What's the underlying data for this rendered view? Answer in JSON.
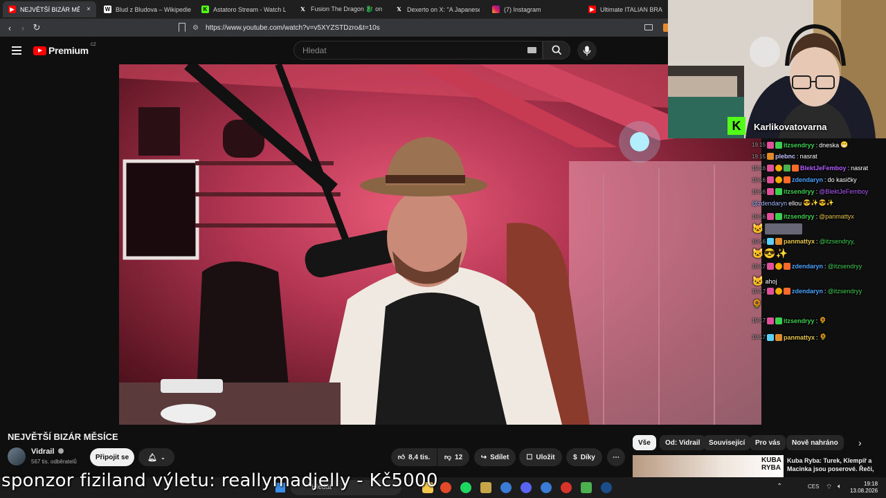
{
  "browser": {
    "tabs": [
      {
        "title": "NEJVĚTŠÍ BIZÁR MĚSÍCE",
        "icon": "youtube-icon",
        "active": true,
        "close": "×"
      },
      {
        "title": "Blud z Bludova – Wikipedie",
        "icon": "wikipedia-icon"
      },
      {
        "title": "Astatoro Stream - Watch Live",
        "icon": "kick-icon"
      },
      {
        "title": "Fusion The Dragon 🐉 on X: \"",
        "icon": "x-icon"
      },
      {
        "title": "Dexerto on X: \"A Japanese ind",
        "icon": "x-icon"
      },
      {
        "title": "(7) Instagram",
        "icon": "instagram-icon"
      },
      {
        "title": "Ultimate ITALIAN BRAINROT",
        "icon": "youtube-icon"
      }
    ],
    "url": "https://www.youtube.com/watch?v=v5XYZSTDzro&t=10s"
  },
  "youtube": {
    "logo_text": "Premium",
    "region": "CZ",
    "search_placeholder": "Hledat",
    "video_title": "NEJVĚTŠÍ BIZÁR MĚSÍCE",
    "channel_name": "Vidrail",
    "subscribers": "567 tis. odběratelů",
    "join_label": "Připojit se",
    "likes": "8,4 tis.",
    "dislikes": "12",
    "share_label": "Sdílet",
    "save_label": "Uložit",
    "thanks_label": "Díky",
    "chips": [
      "Vše",
      "Od: Vidrail",
      "Související",
      "Pro vás",
      "Nově nahráno"
    ],
    "recommended": {
      "title": "Kuba Ryba: Turek, Klempíř a Macinka jsou poserové. Řeči,",
      "thumb_text": "KUBA RYBA"
    }
  },
  "stream": {
    "channel": "Karlikovatovarna",
    "chat": [
      {
        "time": "19:15",
        "user": "itzsendryy",
        "color": "#3ecf4e",
        "text": "dneska"
      },
      {
        "time": "19:15",
        "user": "plebnc",
        "color": "#c2c2ff",
        "text": "nasrat"
      },
      {
        "time": "19:16",
        "user": "BlektJeFemboy",
        "color": "#b05cff",
        "text": "nasrat"
      },
      {
        "time": "19:16",
        "user": "zdendaryn",
        "color": "#4aa3ff",
        "text": "do kasičky"
      },
      {
        "time": "19:16",
        "user": "itzsendryy",
        "color": "#3ecf4e",
        "text": "@BlektJeFemboy"
      },
      {
        "time": "",
        "user": "@zdendaryn",
        "color": "#9db8ff",
        "text": "ellou"
      },
      {
        "time": "19:16",
        "user": "itzsendryy",
        "color": "#3ecf4e",
        "text": "@panmattyx"
      },
      {
        "time": "19:16",
        "user": "panmattyx",
        "color": "#e6c44a",
        "text": "@itzsendryy,"
      },
      {
        "time": "19:17",
        "user": "zdendaryn",
        "color": "#4aa3ff",
        "text": "@itzsendryy"
      },
      {
        "time": "",
        "user": "",
        "color": "#ffffff",
        "text": "ahoj"
      },
      {
        "time": "19:17",
        "user": "zdendaryn",
        "color": "#4aa3ff",
        "text": "@itzsendryy"
      },
      {
        "time": "19:17",
        "user": "itzsendryy",
        "color": "#3ecf4e",
        "text": ""
      },
      {
        "time": "19:17",
        "user": "panmattyx",
        "color": "#e6c44a",
        "text": ""
      }
    ]
  },
  "ticker": "sponzor fiziland výletu: reallymadjelly - Kč5000",
  "taskbar": {
    "search": "Hledat",
    "lang": "CES",
    "time": "19:18",
    "date": "13.08.2026"
  }
}
